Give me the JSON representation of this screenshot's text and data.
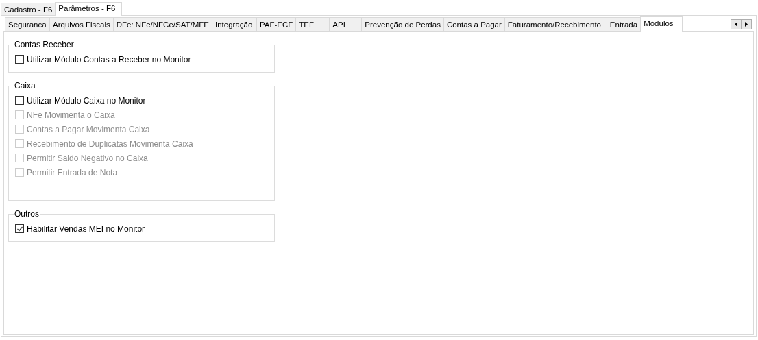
{
  "outer_tabs": [
    {
      "label": "Cadastro - F6",
      "selected": false
    },
    {
      "label": "Parâmetros - F6",
      "selected": true
    }
  ],
  "tabs": [
    {
      "label": "Seguranca",
      "selected": false
    },
    {
      "label": "Arquivos Fiscais",
      "selected": false
    },
    {
      "label": "DFe: NFe/NFCe/SAT/MFE",
      "selected": false
    },
    {
      "label": "Integração",
      "selected": false
    },
    {
      "label": "PAF-ECF",
      "selected": false
    },
    {
      "label": "TEF",
      "selected": false
    },
    {
      "label": "API",
      "selected": false
    },
    {
      "label": "Prevenção de Perdas",
      "selected": false
    },
    {
      "label": "Contas a Pagar",
      "selected": false
    },
    {
      "label": "Faturamento/Recebimento",
      "selected": false
    },
    {
      "label": "Entrada",
      "selected": false
    },
    {
      "label": "Módulos",
      "selected": true
    }
  ],
  "groups": [
    {
      "title": "Contas Receber",
      "options": [
        {
          "label": "Utilizar Módulo Contas a Receber no Monitor",
          "checked": false,
          "disabled": false
        }
      ]
    },
    {
      "title": "Caixa",
      "options": [
        {
          "label": "Utilizar Módulo Caixa no Monitor",
          "checked": false,
          "disabled": false
        },
        {
          "label": "NFe Movimenta o Caixa",
          "checked": false,
          "disabled": true
        },
        {
          "label": "Contas a Pagar Movimenta Caixa",
          "checked": false,
          "disabled": true
        },
        {
          "label": "Recebimento de Duplicatas Movimenta Caixa",
          "checked": false,
          "disabled": true
        },
        {
          "label": "Permitir Saldo Negativo no Caixa",
          "checked": false,
          "disabled": true
        },
        {
          "label": "Permitir Entrada de Nota",
          "checked": false,
          "disabled": true
        }
      ]
    },
    {
      "title": "Outros",
      "options": [
        {
          "label": "Habilitar Vendas MEI no Monitor",
          "checked": true,
          "disabled": false
        }
      ]
    }
  ]
}
